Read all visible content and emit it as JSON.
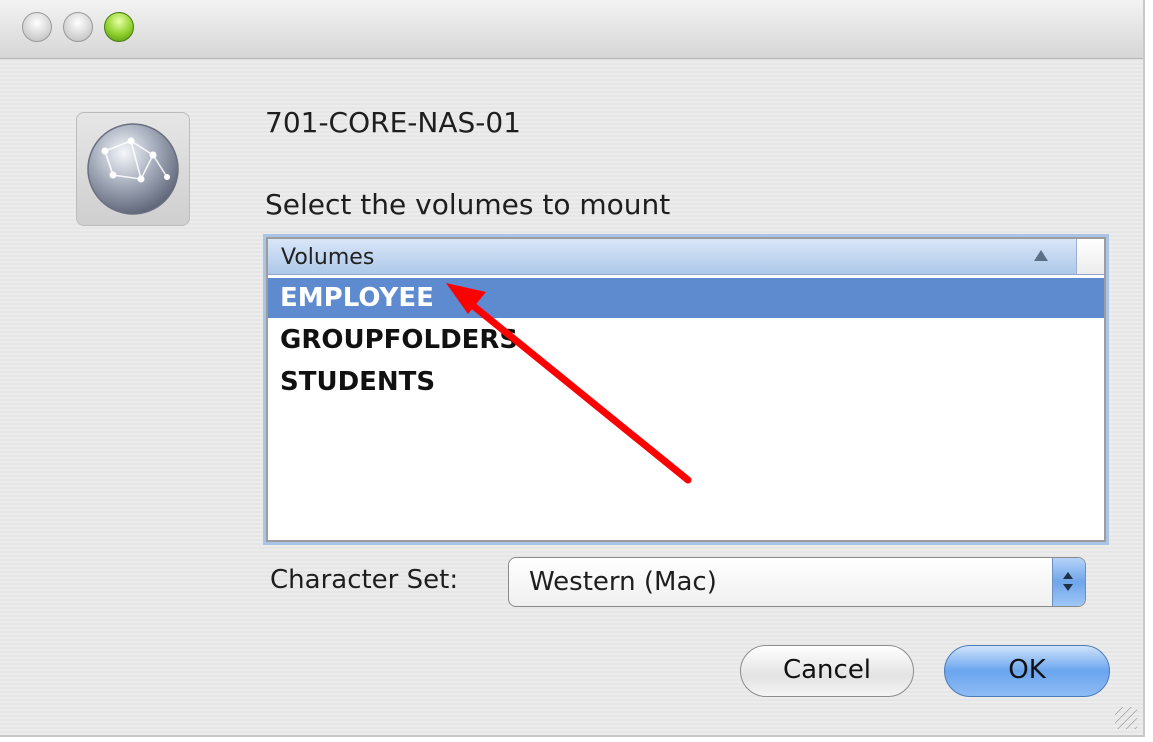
{
  "dialog": {
    "server_name": "701-CORE-NAS-01",
    "instruction": "Select the volumes to mount",
    "icon": "network-globe-icon"
  },
  "volumes": {
    "column_header": "Volumes",
    "sort": "ascending",
    "items": [
      "EMPLOYEE",
      "GROUPFOLDERS",
      "STUDENTS"
    ],
    "selected": "EMPLOYEE"
  },
  "charset": {
    "label": "Character Set:",
    "value": "Western (Mac)"
  },
  "buttons": {
    "cancel": "Cancel",
    "ok": "OK"
  },
  "colors": {
    "selection": "#5e8ad0",
    "default_button": "#6aa4ee",
    "annotation_arrow": "#ff0000"
  }
}
